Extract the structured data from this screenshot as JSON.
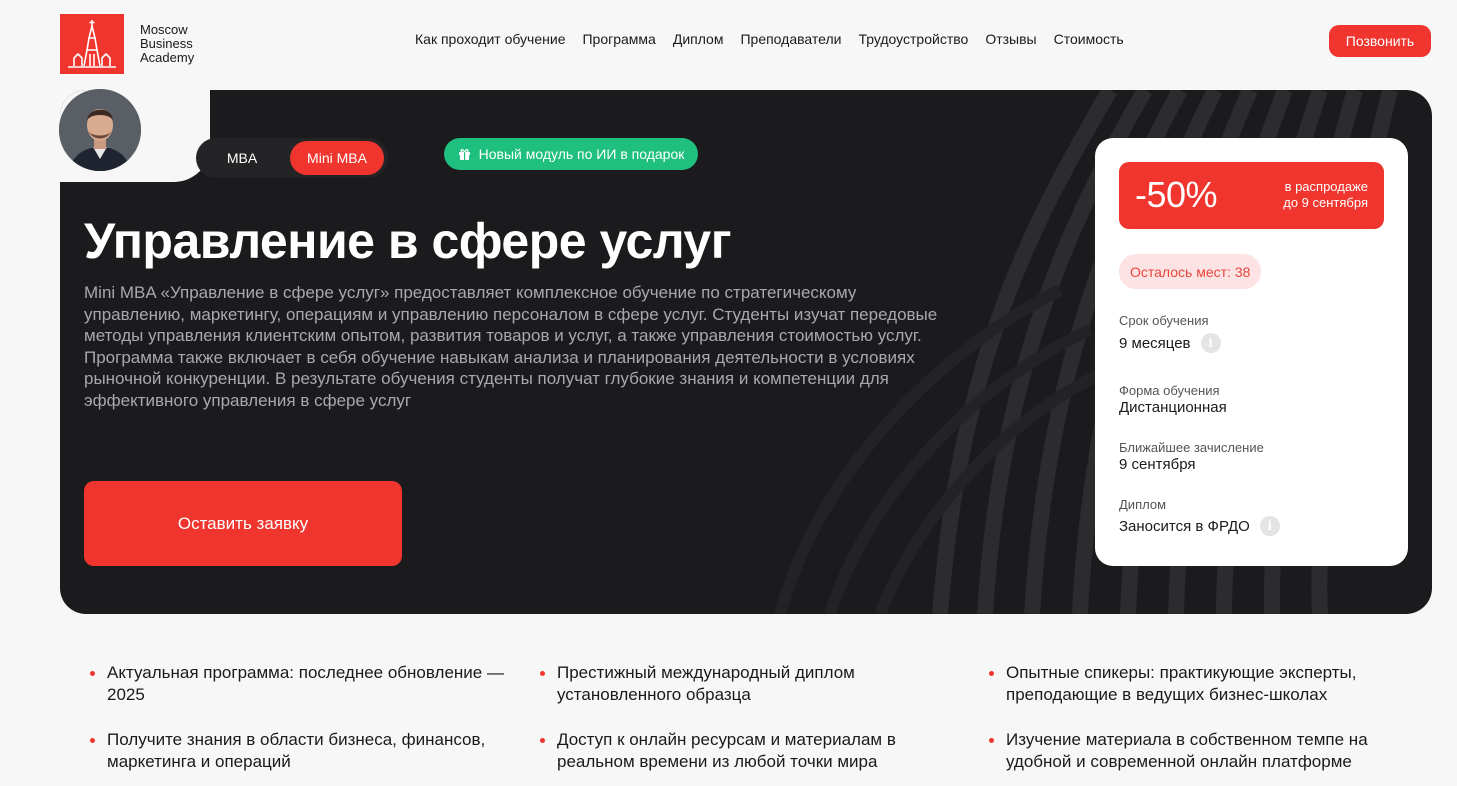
{
  "header": {
    "logo_text": [
      "Moscow",
      "Business",
      "Academy"
    ],
    "nav": [
      "Как проходит обучение",
      "Программа",
      "Диплом",
      "Преподаватели",
      "Трудоустройство",
      "Отзывы",
      "Стоимость"
    ],
    "call_button": "Позвонить"
  },
  "hero": {
    "toggle": {
      "mba": "MBA",
      "mini_mba": "Mini MBA"
    },
    "ai_badge": "Новый модуль по ИИ в подарок",
    "title": "Управление в сфере услуг",
    "description": "Mini MBA «Управление в сфере услуг» предоставляет комплексное обучение по стратегическому управлению, маркетингу, операциям и управлению персоналом в сфере услуг. Студенты изучат передовые методы управления клиентским опытом, развития товаров и услуг, а также управления стоимостью услуг. Программа также включает в себя обучение навыкам анализа и планирования деятельности в условиях рыночной конкуренции. В результате обучения студенты получат глубокие знания и компетенции для эффективного управления в сфере услуг",
    "apply_button": "Оставить заявку"
  },
  "card": {
    "sale_percent": "-50%",
    "sale_note_1": "в распродаже",
    "sale_note_2": "до 9 сентября",
    "seats": "Осталось мест: 38",
    "duration_label": "Срок обучения",
    "duration_value": "9 месяцев",
    "format_label": "Форма обучения",
    "format_value": "Дистанционная",
    "enroll_label": "Ближайшее зачисление",
    "enroll_value": "9 сентября",
    "diploma_label": "Диплом",
    "diploma_value": "Заносится в ФРДО"
  },
  "features": [
    "Актуальная программа: последнее обновление — 2025",
    "Престижный международный диплом установленного образца",
    "Опытные спикеры: практикующие эксперты, преподающие в ведущих бизнес-школах",
    "Получите знания в области бизнеса, финансов, маркетинга и операций",
    "Доступ к онлайн ресурсам и материалам в реальном времени из любой точки мира",
    "Изучение материала в собственном темпе на удобной и современной онлайн платформе"
  ],
  "colors": {
    "accent": "#f0352e",
    "hero_bg": "#1b1b1d",
    "badge_green": "#1fbf7f"
  }
}
